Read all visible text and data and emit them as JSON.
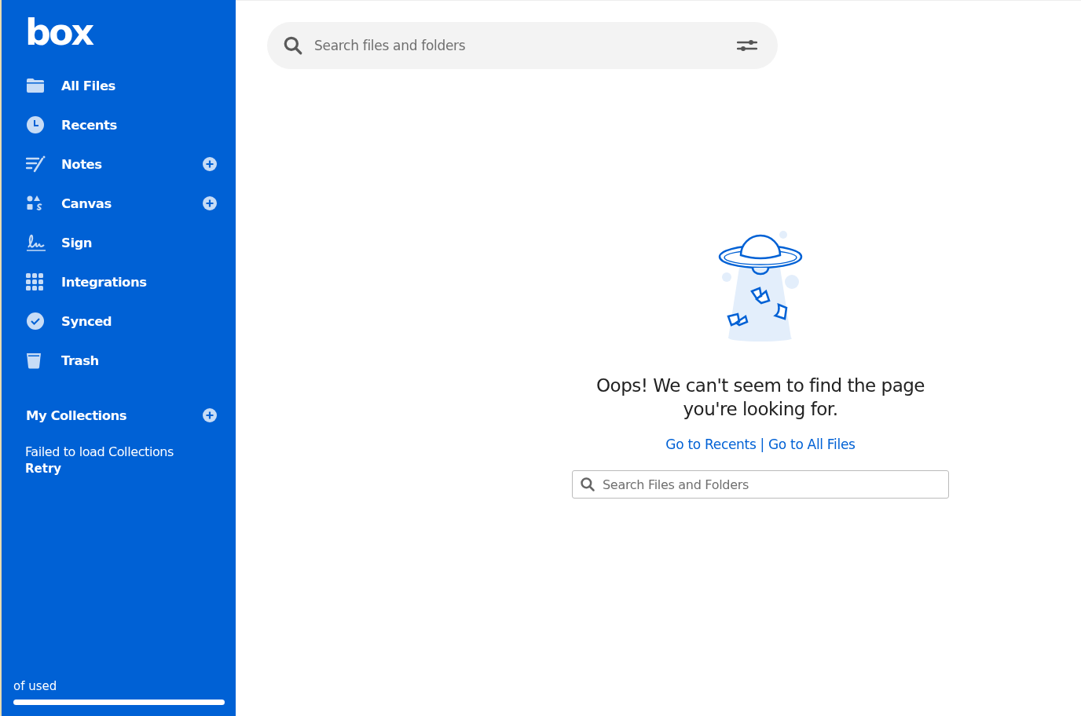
{
  "sidebar": {
    "logo": "box",
    "items": [
      {
        "label": "All Files",
        "has_add_button": false
      },
      {
        "label": "Recents",
        "has_add_button": false
      },
      {
        "label": "Notes",
        "has_add_button": true
      },
      {
        "label": "Canvas",
        "has_add_button": true
      },
      {
        "label": "Sign",
        "has_add_button": false
      },
      {
        "label": "Integrations",
        "has_add_button": false
      },
      {
        "label": "Synced",
        "has_add_button": false
      },
      {
        "label": "Trash",
        "has_add_button": false
      }
    ],
    "collections": {
      "title": "My Collections",
      "has_add_button": true,
      "error": "Failed to load Collections",
      "retry": "Retry"
    },
    "storage": {
      "label": "of used",
      "level": 1
    }
  },
  "search": {
    "placeholder": "Search files and folders"
  },
  "not_found": {
    "message": "Oops! We can't seem to find the page you're looking for.",
    "links": [
      "Go to Recents",
      "Go to All Files"
    ],
    "separator": "|",
    "search_placeholder": "Search Files and Folders"
  }
}
